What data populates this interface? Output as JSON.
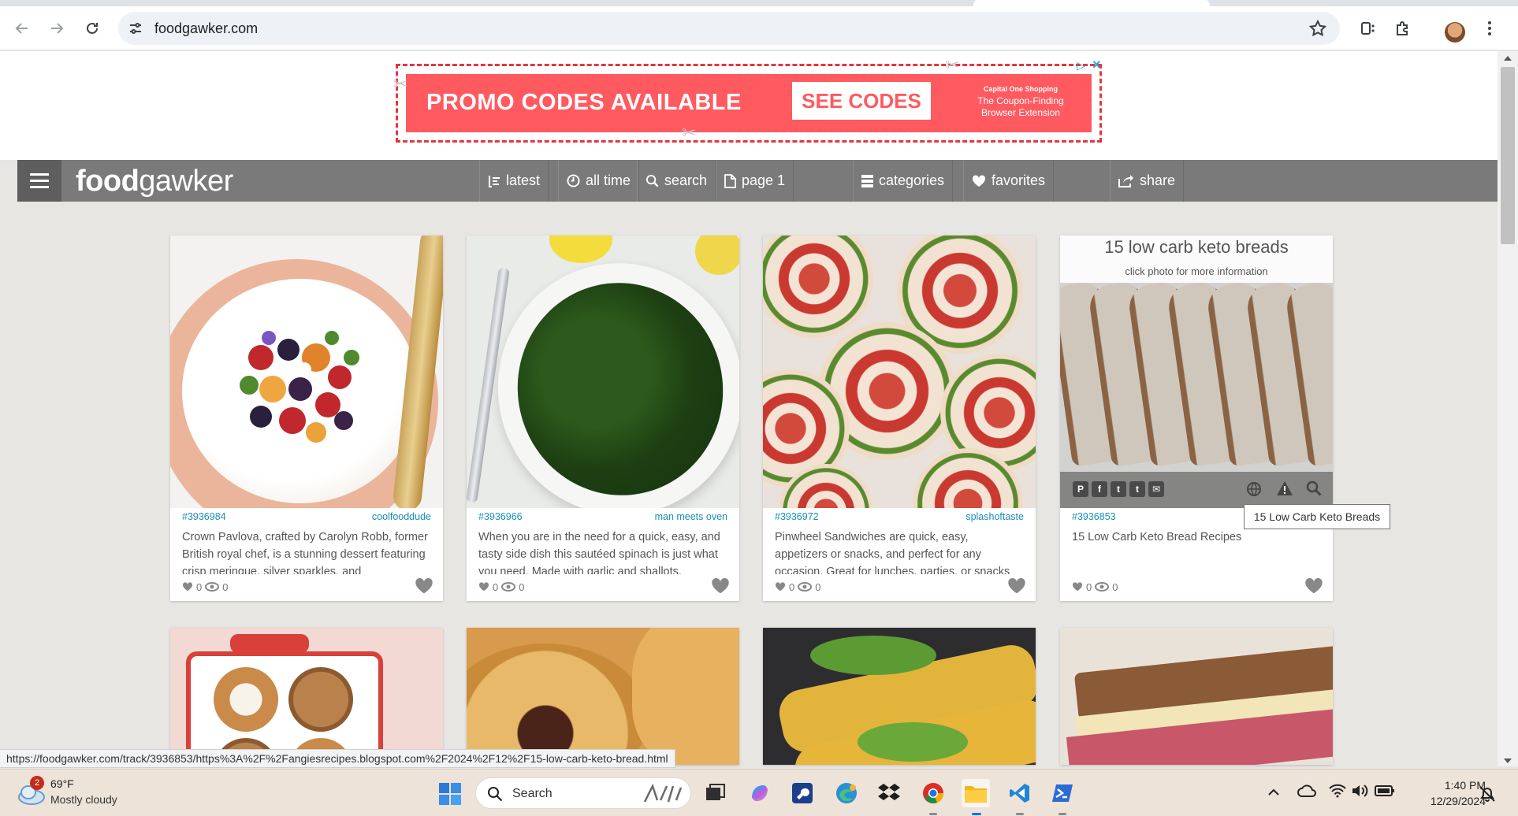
{
  "browser": {
    "url": "foodgawker.com",
    "status_url": "https://foodgawker.com/track/3936853/https%3A%2F%2Fangiesrecipes.blogspot.com%2F2024%2F12%2F15-low-carb-keto-bread.html"
  },
  "ad": {
    "promo_text": "PROMO CODES AVAILABLE",
    "cta_label": "SEE CODES",
    "brand_line1": "Capital One Shopping",
    "brand_line2": "The Coupon-Finding",
    "brand_line3": "Browser Extension"
  },
  "site": {
    "logo_bold": "food",
    "logo_light": "gawker",
    "nav": {
      "latest": "latest",
      "all_time": "all time",
      "search": "search",
      "page": "page 1",
      "categories": "categories",
      "favorites": "favorites",
      "share": "share"
    }
  },
  "cards": [
    {
      "id": "#3936984",
      "author": "coolfooddude",
      "description": "Crown Pavlova, crafted by Carolyn Robb, former British royal chef, is a stunning dessert featuring crisp meringue, silver sparkles, and",
      "likes": "0",
      "views": "0"
    },
    {
      "id": "#3936966",
      "author": "man meets oven",
      "description": "When you are in the need for a quick, easy, and tasty side dish this sautéed spinach is just what you need. Made with garlic and shallots.",
      "likes": "0",
      "views": "0"
    },
    {
      "id": "#3936972",
      "author": "splashoftaste",
      "description": "Pinwheel Sandwiches are quick, easy, appetizers or snacks, and perfect for any occasion. Great for lunches, parties, or snacks on the go.",
      "likes": "0",
      "views": "0"
    },
    {
      "id": "#3936853",
      "author": "",
      "description": "15 Low Carb Keto Bread Recipes",
      "likes": "0",
      "views": "0",
      "overlay_title": "15 low carb keto breads",
      "overlay_hint": "click photo for more information",
      "tooltip": "15 Low Carb Keto Breads"
    }
  ],
  "taskbar": {
    "weather_temp": "69°F",
    "weather_condition": "Mostly cloudy",
    "weather_badge": "2",
    "search_label": "Search",
    "time": "1:40 PM",
    "date": "12/29/2024"
  },
  "colors": {
    "nav_bg": "#7a7a7a",
    "link_blue": "#1a8eb5",
    "ad_red": "#ff5a60"
  }
}
